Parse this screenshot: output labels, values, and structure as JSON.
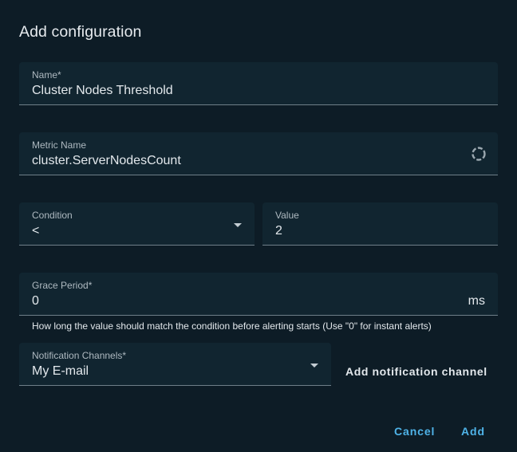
{
  "dialog": {
    "title": "Add configuration"
  },
  "fields": {
    "name": {
      "label": "Name*",
      "value": "Cluster Nodes Threshold"
    },
    "metric": {
      "label": "Metric Name",
      "value": "cluster.ServerNodesCount",
      "icon": "loading-spinner-icon"
    },
    "condition": {
      "label": "Condition",
      "value": "<",
      "icon": "dropdown-caret-icon"
    },
    "threshold": {
      "label": "Value",
      "value": "2"
    },
    "grace_period": {
      "label": "Grace Period*",
      "value": "0",
      "unit": "ms",
      "hint": "How long the value should match the condition before alerting starts (Use \"0\" for instant alerts)"
    },
    "channels": {
      "label": "Notification Channels*",
      "value": "My E-mail",
      "icon": "dropdown-caret-icon"
    }
  },
  "buttons": {
    "add_channel": "Add notification channel",
    "cancel": "Cancel",
    "add": "Add"
  },
  "colors": {
    "background": "#0d1c26",
    "field_background": "#112530",
    "accent": "#4fb3e8",
    "text": "#e3e8ec"
  }
}
